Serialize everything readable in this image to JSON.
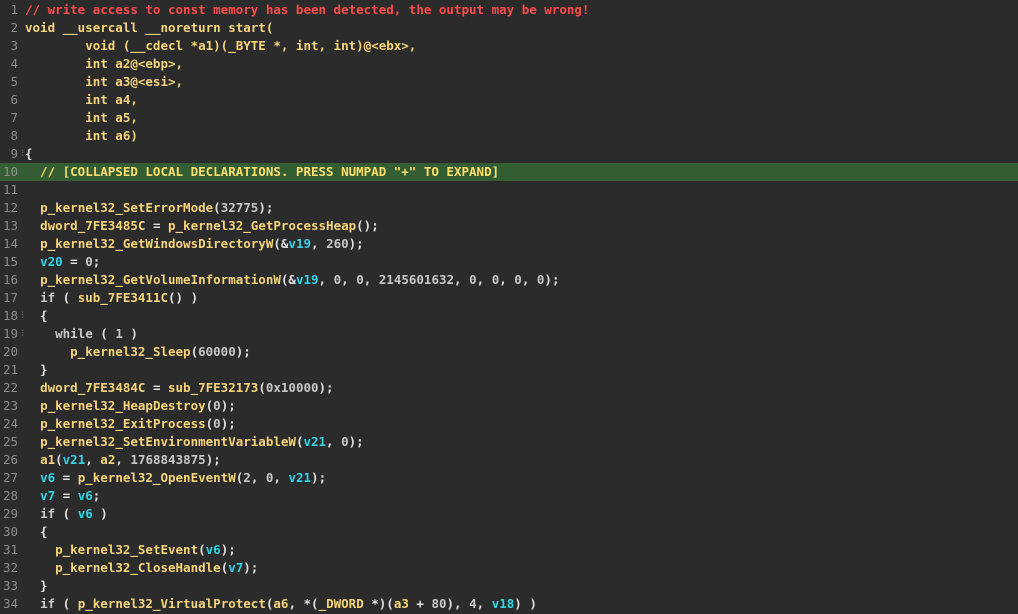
{
  "lines": [
    {
      "n": "1",
      "tokens": [
        {
          "t": "// write access to const memory has been detected, the output may be wrong!",
          "c": "warn"
        }
      ]
    },
    {
      "n": "2",
      "tokens": [
        {
          "t": "void __usercall __noreturn start(",
          "c": "kw"
        }
      ]
    },
    {
      "n": "3",
      "tokens": [
        {
          "t": "        void (__cdecl *a1)(_BYTE *, int, int)@<ebx>,",
          "c": "kw"
        }
      ]
    },
    {
      "n": "4",
      "tokens": [
        {
          "t": "        int a2@<ebp>,",
          "c": "kw"
        }
      ]
    },
    {
      "n": "5",
      "tokens": [
        {
          "t": "        int a3@<esi>,",
          "c": "kw"
        }
      ]
    },
    {
      "n": "6",
      "tokens": [
        {
          "t": "        int a4,",
          "c": "kw"
        }
      ]
    },
    {
      "n": "7",
      "tokens": [
        {
          "t": "        int a5,",
          "c": "kw"
        }
      ]
    },
    {
      "n": "8",
      "tokens": [
        {
          "t": "        int a6)",
          "c": "kw"
        }
      ]
    },
    {
      "n": "9",
      "fold": true,
      "tokens": [
        {
          "t": "{",
          "c": "plain"
        }
      ]
    },
    {
      "n": "10",
      "hl": true,
      "tokens": [
        {
          "t": "  // [COLLAPSED LOCAL DECLARATIONS. PRESS NUMPAD \"+\" TO EXPAND]",
          "c": "coll"
        }
      ]
    },
    {
      "n": "11",
      "tokens": []
    },
    {
      "n": "12",
      "tokens": [
        {
          "t": "  ",
          "c": "plain"
        },
        {
          "t": "p_kernel32_SetErrorMode",
          "c": "fn"
        },
        {
          "t": "(",
          "c": "plain"
        },
        {
          "t": "32775",
          "c": "num"
        },
        {
          "t": ");",
          "c": "plain"
        }
      ]
    },
    {
      "n": "13",
      "tokens": [
        {
          "t": "  ",
          "c": "plain"
        },
        {
          "t": "dword_7FE3485C",
          "c": "fn"
        },
        {
          "t": " = ",
          "c": "plain"
        },
        {
          "t": "p_kernel32_GetProcessHeap",
          "c": "fn"
        },
        {
          "t": "();",
          "c": "plain"
        }
      ]
    },
    {
      "n": "14",
      "tokens": [
        {
          "t": "  ",
          "c": "plain"
        },
        {
          "t": "p_kernel32_GetWindowsDirectoryW",
          "c": "fn"
        },
        {
          "t": "(&",
          "c": "plain"
        },
        {
          "t": "v19",
          "c": "var"
        },
        {
          "t": ", ",
          "c": "plain"
        },
        {
          "t": "260",
          "c": "num"
        },
        {
          "t": ");",
          "c": "plain"
        }
      ]
    },
    {
      "n": "15",
      "tokens": [
        {
          "t": "  ",
          "c": "plain"
        },
        {
          "t": "v20",
          "c": "var"
        },
        {
          "t": " = ",
          "c": "plain"
        },
        {
          "t": "0",
          "c": "num"
        },
        {
          "t": ";",
          "c": "plain"
        }
      ]
    },
    {
      "n": "16",
      "tokens": [
        {
          "t": "  ",
          "c": "plain"
        },
        {
          "t": "p_kernel32_GetVolumeInformationW",
          "c": "fn"
        },
        {
          "t": "(&",
          "c": "plain"
        },
        {
          "t": "v19",
          "c": "var"
        },
        {
          "t": ", ",
          "c": "plain"
        },
        {
          "t": "0",
          "c": "num"
        },
        {
          "t": ", ",
          "c": "plain"
        },
        {
          "t": "0",
          "c": "num"
        },
        {
          "t": ", ",
          "c": "plain"
        },
        {
          "t": "2145601632",
          "c": "num"
        },
        {
          "t": ", ",
          "c": "plain"
        },
        {
          "t": "0",
          "c": "num"
        },
        {
          "t": ", ",
          "c": "plain"
        },
        {
          "t": "0",
          "c": "num"
        },
        {
          "t": ", ",
          "c": "plain"
        },
        {
          "t": "0",
          "c": "num"
        },
        {
          "t": ", ",
          "c": "plain"
        },
        {
          "t": "0",
          "c": "num"
        },
        {
          "t": ");",
          "c": "plain"
        }
      ]
    },
    {
      "n": "17",
      "tokens": [
        {
          "t": "  ",
          "c": "plain"
        },
        {
          "t": "if",
          "c": "dim"
        },
        {
          "t": " ( ",
          "c": "plain"
        },
        {
          "t": "sub_7FE3411C",
          "c": "fn"
        },
        {
          "t": "() )",
          "c": "plain"
        }
      ]
    },
    {
      "n": "18",
      "fold": true,
      "tokens": [
        {
          "t": "  {",
          "c": "plain"
        }
      ]
    },
    {
      "n": "19",
      "fold": true,
      "tokens": [
        {
          "t": "    ",
          "c": "plain"
        },
        {
          "t": "while",
          "c": "dim"
        },
        {
          "t": " ( ",
          "c": "plain"
        },
        {
          "t": "1",
          "c": "num"
        },
        {
          "t": " )",
          "c": "plain"
        }
      ]
    },
    {
      "n": "20",
      "tokens": [
        {
          "t": "      ",
          "c": "plain"
        },
        {
          "t": "p_kernel32_Sleep",
          "c": "fn"
        },
        {
          "t": "(",
          "c": "plain"
        },
        {
          "t": "60000",
          "c": "num"
        },
        {
          "t": ");",
          "c": "plain"
        }
      ]
    },
    {
      "n": "21",
      "tokens": [
        {
          "t": "  }",
          "c": "plain"
        }
      ]
    },
    {
      "n": "22",
      "tokens": [
        {
          "t": "  ",
          "c": "plain"
        },
        {
          "t": "dword_7FE3484C",
          "c": "fn"
        },
        {
          "t": " = ",
          "c": "plain"
        },
        {
          "t": "sub_7FE32173",
          "c": "fn"
        },
        {
          "t": "(",
          "c": "plain"
        },
        {
          "t": "0x10000",
          "c": "num"
        },
        {
          "t": ");",
          "c": "plain"
        }
      ]
    },
    {
      "n": "23",
      "tokens": [
        {
          "t": "  ",
          "c": "plain"
        },
        {
          "t": "p_kernel32_HeapDestroy",
          "c": "fn"
        },
        {
          "t": "(",
          "c": "plain"
        },
        {
          "t": "0",
          "c": "num"
        },
        {
          "t": ");",
          "c": "plain"
        }
      ]
    },
    {
      "n": "24",
      "tokens": [
        {
          "t": "  ",
          "c": "plain"
        },
        {
          "t": "p_kernel32_ExitProcess",
          "c": "fn"
        },
        {
          "t": "(",
          "c": "plain"
        },
        {
          "t": "0",
          "c": "num"
        },
        {
          "t": ");",
          "c": "plain"
        }
      ]
    },
    {
      "n": "25",
      "tokens": [
        {
          "t": "  ",
          "c": "plain"
        },
        {
          "t": "p_kernel32_SetEnvironmentVariableW",
          "c": "fn"
        },
        {
          "t": "(",
          "c": "plain"
        },
        {
          "t": "v21",
          "c": "var"
        },
        {
          "t": ", ",
          "c": "plain"
        },
        {
          "t": "0",
          "c": "num"
        },
        {
          "t": ");",
          "c": "plain"
        }
      ]
    },
    {
      "n": "26",
      "tokens": [
        {
          "t": "  ",
          "c": "plain"
        },
        {
          "t": "a1",
          "c": "fn"
        },
        {
          "t": "(",
          "c": "plain"
        },
        {
          "t": "v21",
          "c": "var"
        },
        {
          "t": ", ",
          "c": "plain"
        },
        {
          "t": "a2",
          "c": "fn"
        },
        {
          "t": ", ",
          "c": "plain"
        },
        {
          "t": "1768843875",
          "c": "num"
        },
        {
          "t": ");",
          "c": "plain"
        }
      ]
    },
    {
      "n": "27",
      "tokens": [
        {
          "t": "  ",
          "c": "plain"
        },
        {
          "t": "v6",
          "c": "var"
        },
        {
          "t": " = ",
          "c": "plain"
        },
        {
          "t": "p_kernel32_OpenEventW",
          "c": "fn"
        },
        {
          "t": "(",
          "c": "plain"
        },
        {
          "t": "2",
          "c": "num"
        },
        {
          "t": ", ",
          "c": "plain"
        },
        {
          "t": "0",
          "c": "num"
        },
        {
          "t": ", ",
          "c": "plain"
        },
        {
          "t": "v21",
          "c": "var"
        },
        {
          "t": ");",
          "c": "plain"
        }
      ]
    },
    {
      "n": "28",
      "tokens": [
        {
          "t": "  ",
          "c": "plain"
        },
        {
          "t": "v7",
          "c": "var"
        },
        {
          "t": " = ",
          "c": "plain"
        },
        {
          "t": "v6",
          "c": "var"
        },
        {
          "t": ";",
          "c": "plain"
        }
      ]
    },
    {
      "n": "29",
      "tokens": [
        {
          "t": "  ",
          "c": "plain"
        },
        {
          "t": "if",
          "c": "dim"
        },
        {
          "t": " ( ",
          "c": "plain"
        },
        {
          "t": "v6",
          "c": "var"
        },
        {
          "t": " )",
          "c": "plain"
        }
      ]
    },
    {
      "n": "30",
      "tokens": [
        {
          "t": "  {",
          "c": "plain"
        }
      ]
    },
    {
      "n": "31",
      "tokens": [
        {
          "t": "    ",
          "c": "plain"
        },
        {
          "t": "p_kernel32_SetEvent",
          "c": "fn"
        },
        {
          "t": "(",
          "c": "plain"
        },
        {
          "t": "v6",
          "c": "var"
        },
        {
          "t": ");",
          "c": "plain"
        }
      ]
    },
    {
      "n": "32",
      "tokens": [
        {
          "t": "    ",
          "c": "plain"
        },
        {
          "t": "p_kernel32_CloseHandle",
          "c": "fn"
        },
        {
          "t": "(",
          "c": "plain"
        },
        {
          "t": "v7",
          "c": "var"
        },
        {
          "t": ");",
          "c": "plain"
        }
      ]
    },
    {
      "n": "33",
      "tokens": [
        {
          "t": "  }",
          "c": "plain"
        }
      ]
    },
    {
      "n": "34",
      "tokens": [
        {
          "t": "  ",
          "c": "plain"
        },
        {
          "t": "if",
          "c": "dim"
        },
        {
          "t": " ( ",
          "c": "plain"
        },
        {
          "t": "p_kernel32_VirtualProtect",
          "c": "fn"
        },
        {
          "t": "(",
          "c": "plain"
        },
        {
          "t": "a6",
          "c": "fn"
        },
        {
          "t": ", *(",
          "c": "plain"
        },
        {
          "t": "_DWORD",
          "c": "fn"
        },
        {
          "t": " *)(",
          "c": "plain"
        },
        {
          "t": "a3",
          "c": "fn"
        },
        {
          "t": " + ",
          "c": "plain"
        },
        {
          "t": "80",
          "c": "num"
        },
        {
          "t": "), ",
          "c": "plain"
        },
        {
          "t": "4",
          "c": "num"
        },
        {
          "t": ", ",
          "c": "plain"
        },
        {
          "t": "v18",
          "c": "var"
        },
        {
          "t": ") )",
          "c": "plain"
        }
      ]
    }
  ],
  "fold_glyph": "⁝"
}
